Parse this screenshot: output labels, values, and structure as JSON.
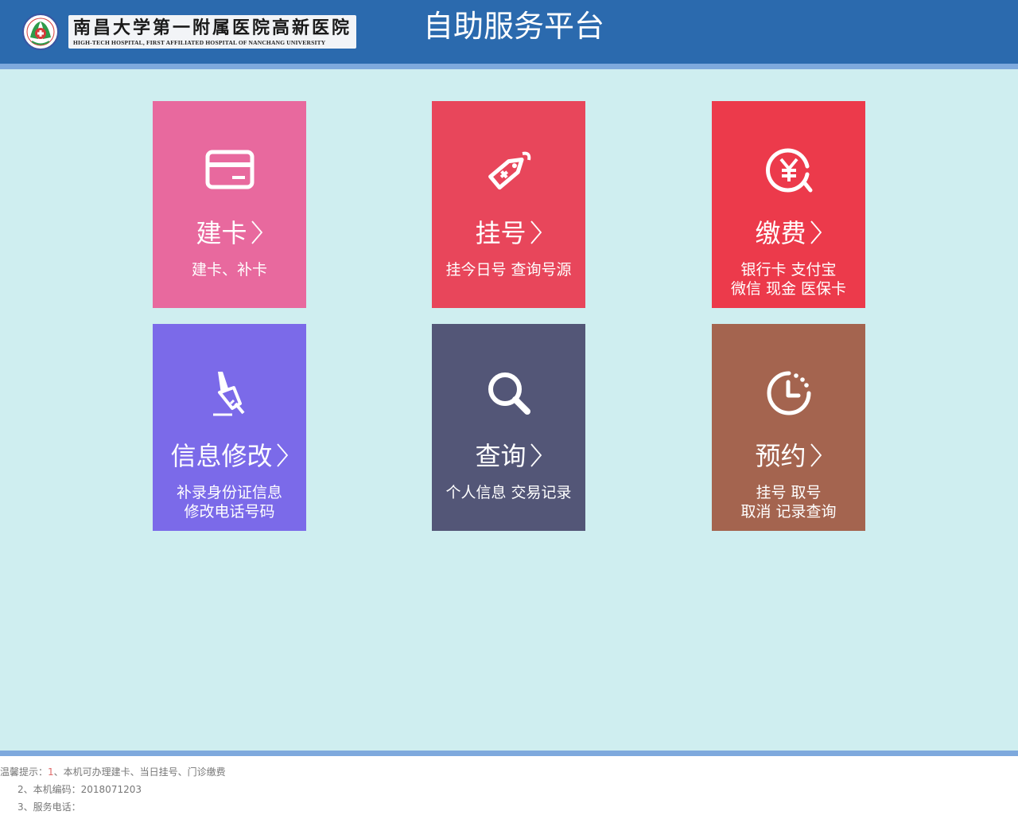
{
  "header": {
    "logo_cn": "南昌大学第一附属医院高新医院",
    "logo_en": "HIGH-TECH HOSPITAL, FIRST AFFILIATED HOSPITAL OF NANCHANG UNIVERSITY",
    "app_title": "自助服务平台",
    "background_color": "#2b6aae"
  },
  "tiles": [
    {
      "id": "build-card",
      "title": "建卡",
      "subtitle_lines": [
        "建卡、补卡"
      ],
      "icon": "card-icon",
      "color": "#e8699e"
    },
    {
      "id": "register",
      "title": "挂号",
      "subtitle_lines": [
        "挂今日号  查询号源"
      ],
      "icon": "tag-icon",
      "color": "#e8465b"
    },
    {
      "id": "payment",
      "title": "缴费",
      "subtitle_lines": [
        "银行卡  支付宝",
        "微信  现金  医保卡"
      ],
      "icon": "yuan-icon",
      "color": "#ec3a4b"
    },
    {
      "id": "info-edit",
      "title": "信息修改",
      "subtitle_lines": [
        "补录身份证信息",
        "修改电话号码"
      ],
      "icon": "pen-icon",
      "color": "#7b6ae9"
    },
    {
      "id": "query",
      "title": "查询",
      "subtitle_lines": [
        "个人信息  交易记录"
      ],
      "icon": "magnifier-icon",
      "color": "#535677"
    },
    {
      "id": "appointment",
      "title": "预约",
      "subtitle_lines": [
        "挂号  取号",
        "取消  记录查询"
      ],
      "icon": "clock-icon",
      "color": "#a4644f"
    }
  ],
  "footer": {
    "tip_label": "温馨提示：",
    "tips": [
      {
        "num": "1",
        "text": "、本机可办理建卡、当日挂号、门诊缴费"
      },
      {
        "num": "2",
        "text": "、本机编码：2018071203"
      },
      {
        "num": "3",
        "text": "、服务电话："
      }
    ]
  }
}
